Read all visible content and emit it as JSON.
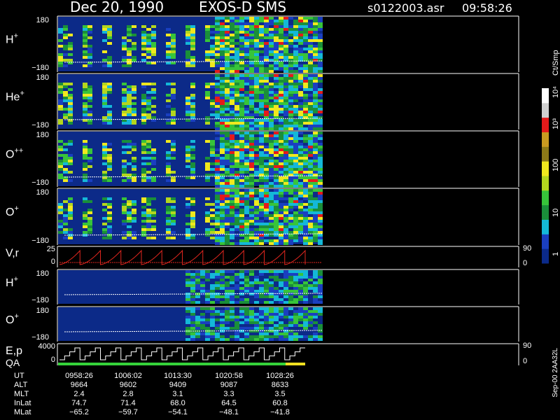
{
  "header": {
    "date": "Dec 20, 1990",
    "instrument": "EXOS-D SMS",
    "file": "s0122003.asr",
    "time": "09:58:26"
  },
  "footer_right": "Sep-00 2AA32L",
  "colorbar": {
    "unit_label": "Ct/Smp",
    "ticks": [
      "1",
      "10",
      "100",
      "10³",
      "10⁴"
    ],
    "stops": [
      "#0b2a8a",
      "#1a3fc0",
      "#14b8d8",
      "#1a8f3a",
      "#37c43a",
      "#b4d61e",
      "#f0e81e",
      "#8c7a18",
      "#c99b20",
      "#e51a1a",
      "#d1d1d1",
      "#ffffff"
    ]
  },
  "chart_data": [
    {
      "type": "heatmap",
      "panel": "H+",
      "ylabel": "H+",
      "ytick_top": "180",
      "ytick_bottom": "−180",
      "ylim": [
        -180,
        180
      ]
    },
    {
      "type": "heatmap",
      "panel": "He+",
      "ylabel": "He+",
      "ytick_top": "180",
      "ytick_bottom": "−180",
      "ylim": [
        -180,
        180
      ]
    },
    {
      "type": "heatmap",
      "panel": "O++",
      "ylabel": "O++",
      "ytick_top": "180",
      "ytick_bottom": "−180",
      "ylim": [
        -180,
        180
      ]
    },
    {
      "type": "heatmap",
      "panel": "O+",
      "ylabel": "O+",
      "ytick_top": "180",
      "ytick_bottom": "−180",
      "ylim": [
        -180,
        180
      ]
    },
    {
      "type": "line",
      "panel": "V,r",
      "ylabel": "V,r",
      "ytick_left": [
        "25",
        "0"
      ],
      "ytick_right": [
        "90",
        "0"
      ],
      "color": "#e0261e",
      "pattern": "sawtooth",
      "cycles": 12
    },
    {
      "type": "heatmap",
      "panel": "H+ (low)",
      "ylabel": "H+",
      "ytick_top": "180",
      "ytick_bottom": "−180",
      "ylim": [
        -180,
        180
      ]
    },
    {
      "type": "heatmap",
      "panel": "O+ (low)",
      "ylabel": "O+",
      "ytick_top": "180",
      "ytick_bottom": "−180",
      "ylim": [
        -180,
        180
      ]
    },
    {
      "type": "line",
      "panel": "E,p QA",
      "ylabel": "E,p",
      "ylabel2": "QA",
      "ytick_left": [
        "4000",
        "0"
      ],
      "ytick_right": [
        "90",
        "0"
      ],
      "color": "#ffffff",
      "pattern": "staircase",
      "cycles": 12,
      "qa_colors": [
        "#35d23a",
        "#f0e020"
      ]
    },
    {
      "type": "table",
      "rows": [
        {
          "label": "UT",
          "values": [
            "0958:26",
            "1006:02",
            "1013:30",
            "1020:58",
            "1028:26"
          ]
        },
        {
          "label": "ALT",
          "values": [
            "9664",
            "9602",
            "9409",
            "9087",
            "8633"
          ]
        },
        {
          "label": "MLT",
          "values": [
            "2.4",
            "2.8",
            "3.1",
            "3.3",
            "3.5"
          ]
        },
        {
          "label": "InLat",
          "values": [
            "74.7",
            "71.4",
            "68.0",
            "64.5",
            "60.8"
          ]
        },
        {
          "label": "MLat",
          "values": [
            "−65.2",
            "−59.7",
            "−54.1",
            "−48.1",
            "−41.8"
          ]
        }
      ]
    }
  ]
}
